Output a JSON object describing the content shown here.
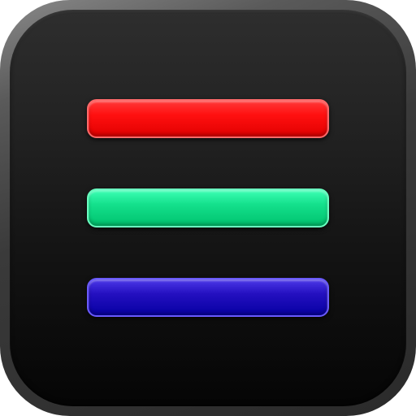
{
  "icon": {
    "name": "hamburger-menu-icon",
    "bars": [
      {
        "name": "red-bar",
        "color": "#ff1010"
      },
      {
        "name": "green-bar",
        "color": "#14e08c"
      },
      {
        "name": "blue-bar",
        "color": "#2410c0"
      }
    ],
    "frame_color": "#6e6e6e",
    "face_color": "#1a1a1a"
  }
}
